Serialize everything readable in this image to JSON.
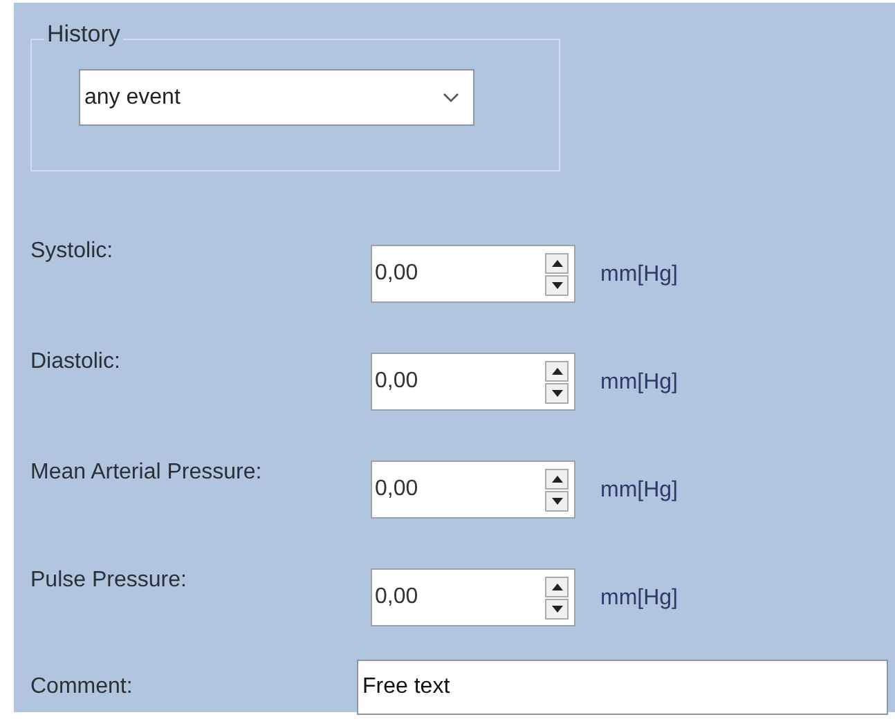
{
  "history": {
    "title": "History",
    "value": "any event"
  },
  "measurements": [
    {
      "label": "Systolic:",
      "value": "0,00",
      "unit": "mm[Hg]"
    },
    {
      "label": "Diastolic:",
      "value": "0,00",
      "unit": "mm[Hg]"
    },
    {
      "label": "Mean Arterial Pressure:",
      "value": "0,00",
      "unit": "mm[Hg]"
    },
    {
      "label": "Pulse Pressure:",
      "value": "0,00",
      "unit": "mm[Hg]"
    }
  ],
  "comment": {
    "label": "Comment:",
    "value": "Free text"
  }
}
